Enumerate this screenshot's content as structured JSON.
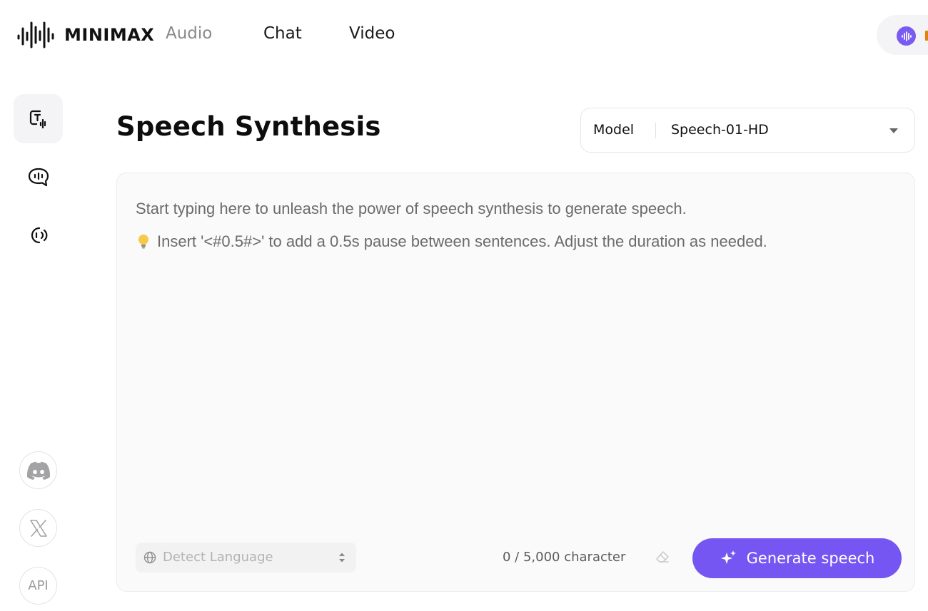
{
  "brand": {
    "name": "MINIMAX",
    "logo_icon": "waveform-logo-icon"
  },
  "nav": {
    "items": [
      {
        "label": "Audio",
        "active": true
      },
      {
        "label": "Chat",
        "active": false
      },
      {
        "label": "Video",
        "active": false
      }
    ]
  },
  "user": {
    "icon": "voice-avatar-icon",
    "accent": "#7a5bf0"
  },
  "sidebar": {
    "tools": [
      {
        "icon": "text-to-speech-icon",
        "active": true
      },
      {
        "icon": "voice-chat-icon",
        "active": false
      },
      {
        "icon": "voice-clone-icon",
        "active": false
      }
    ],
    "social": [
      {
        "icon": "discord-icon"
      },
      {
        "icon": "x-icon"
      },
      {
        "label": "API"
      }
    ]
  },
  "page": {
    "title": "Speech Synthesis"
  },
  "model": {
    "label": "Model",
    "value": "Speech-01-HD"
  },
  "editor": {
    "placeholder_line1": "Start typing here to unleash the power of speech synthesis to generate speech.",
    "placeholder_line2": "Insert '<#0.5#>' to add a 0.5s pause between sentences. Adjust the duration as needed.",
    "hint_icon": "lightbulb-icon"
  },
  "language": {
    "placeholder": "Detect Language"
  },
  "counter": {
    "text": "0 / 5,000 character"
  },
  "generate": {
    "label": "Generate speech",
    "color": "#7656f2"
  }
}
